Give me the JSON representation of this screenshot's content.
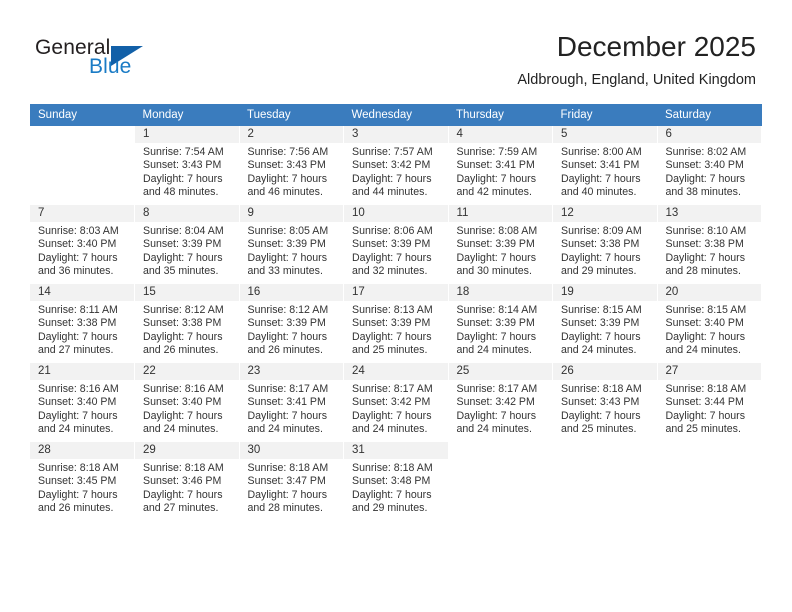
{
  "brand": {
    "name_part1": "General",
    "name_part2": "Blue",
    "accent_color": "#1a7bc5",
    "triangle_color": "#1260a8"
  },
  "header": {
    "title": "December 2025",
    "subtitle": "Aldbrough, England, United Kingdom"
  },
  "calendar": {
    "header_bg": "#3a7cbe",
    "daynum_bg": "#f2f2f2",
    "weekdays": [
      "Sunday",
      "Monday",
      "Tuesday",
      "Wednesday",
      "Thursday",
      "Friday",
      "Saturday"
    ],
    "weeks": [
      [
        {
          "day": "",
          "sunrise": "",
          "sunset": "",
          "daylight_line1": "",
          "daylight_line2": ""
        },
        {
          "day": "1",
          "sunrise": "Sunrise: 7:54 AM",
          "sunset": "Sunset: 3:43 PM",
          "daylight_line1": "Daylight: 7 hours",
          "daylight_line2": "and 48 minutes."
        },
        {
          "day": "2",
          "sunrise": "Sunrise: 7:56 AM",
          "sunset": "Sunset: 3:43 PM",
          "daylight_line1": "Daylight: 7 hours",
          "daylight_line2": "and 46 minutes."
        },
        {
          "day": "3",
          "sunrise": "Sunrise: 7:57 AM",
          "sunset": "Sunset: 3:42 PM",
          "daylight_line1": "Daylight: 7 hours",
          "daylight_line2": "and 44 minutes."
        },
        {
          "day": "4",
          "sunrise": "Sunrise: 7:59 AM",
          "sunset": "Sunset: 3:41 PM",
          "daylight_line1": "Daylight: 7 hours",
          "daylight_line2": "and 42 minutes."
        },
        {
          "day": "5",
          "sunrise": "Sunrise: 8:00 AM",
          "sunset": "Sunset: 3:41 PM",
          "daylight_line1": "Daylight: 7 hours",
          "daylight_line2": "and 40 minutes."
        },
        {
          "day": "6",
          "sunrise": "Sunrise: 8:02 AM",
          "sunset": "Sunset: 3:40 PM",
          "daylight_line1": "Daylight: 7 hours",
          "daylight_line2": "and 38 minutes."
        }
      ],
      [
        {
          "day": "7",
          "sunrise": "Sunrise: 8:03 AM",
          "sunset": "Sunset: 3:40 PM",
          "daylight_line1": "Daylight: 7 hours",
          "daylight_line2": "and 36 minutes."
        },
        {
          "day": "8",
          "sunrise": "Sunrise: 8:04 AM",
          "sunset": "Sunset: 3:39 PM",
          "daylight_line1": "Daylight: 7 hours",
          "daylight_line2": "and 35 minutes."
        },
        {
          "day": "9",
          "sunrise": "Sunrise: 8:05 AM",
          "sunset": "Sunset: 3:39 PM",
          "daylight_line1": "Daylight: 7 hours",
          "daylight_line2": "and 33 minutes."
        },
        {
          "day": "10",
          "sunrise": "Sunrise: 8:06 AM",
          "sunset": "Sunset: 3:39 PM",
          "daylight_line1": "Daylight: 7 hours",
          "daylight_line2": "and 32 minutes."
        },
        {
          "day": "11",
          "sunrise": "Sunrise: 8:08 AM",
          "sunset": "Sunset: 3:39 PM",
          "daylight_line1": "Daylight: 7 hours",
          "daylight_line2": "and 30 minutes."
        },
        {
          "day": "12",
          "sunrise": "Sunrise: 8:09 AM",
          "sunset": "Sunset: 3:38 PM",
          "daylight_line1": "Daylight: 7 hours",
          "daylight_line2": "and 29 minutes."
        },
        {
          "day": "13",
          "sunrise": "Sunrise: 8:10 AM",
          "sunset": "Sunset: 3:38 PM",
          "daylight_line1": "Daylight: 7 hours",
          "daylight_line2": "and 28 minutes."
        }
      ],
      [
        {
          "day": "14",
          "sunrise": "Sunrise: 8:11 AM",
          "sunset": "Sunset: 3:38 PM",
          "daylight_line1": "Daylight: 7 hours",
          "daylight_line2": "and 27 minutes."
        },
        {
          "day": "15",
          "sunrise": "Sunrise: 8:12 AM",
          "sunset": "Sunset: 3:38 PM",
          "daylight_line1": "Daylight: 7 hours",
          "daylight_line2": "and 26 minutes."
        },
        {
          "day": "16",
          "sunrise": "Sunrise: 8:12 AM",
          "sunset": "Sunset: 3:39 PM",
          "daylight_line1": "Daylight: 7 hours",
          "daylight_line2": "and 26 minutes."
        },
        {
          "day": "17",
          "sunrise": "Sunrise: 8:13 AM",
          "sunset": "Sunset: 3:39 PM",
          "daylight_line1": "Daylight: 7 hours",
          "daylight_line2": "and 25 minutes."
        },
        {
          "day": "18",
          "sunrise": "Sunrise: 8:14 AM",
          "sunset": "Sunset: 3:39 PM",
          "daylight_line1": "Daylight: 7 hours",
          "daylight_line2": "and 24 minutes."
        },
        {
          "day": "19",
          "sunrise": "Sunrise: 8:15 AM",
          "sunset": "Sunset: 3:39 PM",
          "daylight_line1": "Daylight: 7 hours",
          "daylight_line2": "and 24 minutes."
        },
        {
          "day": "20",
          "sunrise": "Sunrise: 8:15 AM",
          "sunset": "Sunset: 3:40 PM",
          "daylight_line1": "Daylight: 7 hours",
          "daylight_line2": "and 24 minutes."
        }
      ],
      [
        {
          "day": "21",
          "sunrise": "Sunrise: 8:16 AM",
          "sunset": "Sunset: 3:40 PM",
          "daylight_line1": "Daylight: 7 hours",
          "daylight_line2": "and 24 minutes."
        },
        {
          "day": "22",
          "sunrise": "Sunrise: 8:16 AM",
          "sunset": "Sunset: 3:40 PM",
          "daylight_line1": "Daylight: 7 hours",
          "daylight_line2": "and 24 minutes."
        },
        {
          "day": "23",
          "sunrise": "Sunrise: 8:17 AM",
          "sunset": "Sunset: 3:41 PM",
          "daylight_line1": "Daylight: 7 hours",
          "daylight_line2": "and 24 minutes."
        },
        {
          "day": "24",
          "sunrise": "Sunrise: 8:17 AM",
          "sunset": "Sunset: 3:42 PM",
          "daylight_line1": "Daylight: 7 hours",
          "daylight_line2": "and 24 minutes."
        },
        {
          "day": "25",
          "sunrise": "Sunrise: 8:17 AM",
          "sunset": "Sunset: 3:42 PM",
          "daylight_line1": "Daylight: 7 hours",
          "daylight_line2": "and 24 minutes."
        },
        {
          "day": "26",
          "sunrise": "Sunrise: 8:18 AM",
          "sunset": "Sunset: 3:43 PM",
          "daylight_line1": "Daylight: 7 hours",
          "daylight_line2": "and 25 minutes."
        },
        {
          "day": "27",
          "sunrise": "Sunrise: 8:18 AM",
          "sunset": "Sunset: 3:44 PM",
          "daylight_line1": "Daylight: 7 hours",
          "daylight_line2": "and 25 minutes."
        }
      ],
      [
        {
          "day": "28",
          "sunrise": "Sunrise: 8:18 AM",
          "sunset": "Sunset: 3:45 PM",
          "daylight_line1": "Daylight: 7 hours",
          "daylight_line2": "and 26 minutes."
        },
        {
          "day": "29",
          "sunrise": "Sunrise: 8:18 AM",
          "sunset": "Sunset: 3:46 PM",
          "daylight_line1": "Daylight: 7 hours",
          "daylight_line2": "and 27 minutes."
        },
        {
          "day": "30",
          "sunrise": "Sunrise: 8:18 AM",
          "sunset": "Sunset: 3:47 PM",
          "daylight_line1": "Daylight: 7 hours",
          "daylight_line2": "and 28 minutes."
        },
        {
          "day": "31",
          "sunrise": "Sunrise: 8:18 AM",
          "sunset": "Sunset: 3:48 PM",
          "daylight_line1": "Daylight: 7 hours",
          "daylight_line2": "and 29 minutes."
        },
        {
          "day": "",
          "sunrise": "",
          "sunset": "",
          "daylight_line1": "",
          "daylight_line2": ""
        },
        {
          "day": "",
          "sunrise": "",
          "sunset": "",
          "daylight_line1": "",
          "daylight_line2": ""
        },
        {
          "day": "",
          "sunrise": "",
          "sunset": "",
          "daylight_line1": "",
          "daylight_line2": ""
        }
      ]
    ]
  }
}
